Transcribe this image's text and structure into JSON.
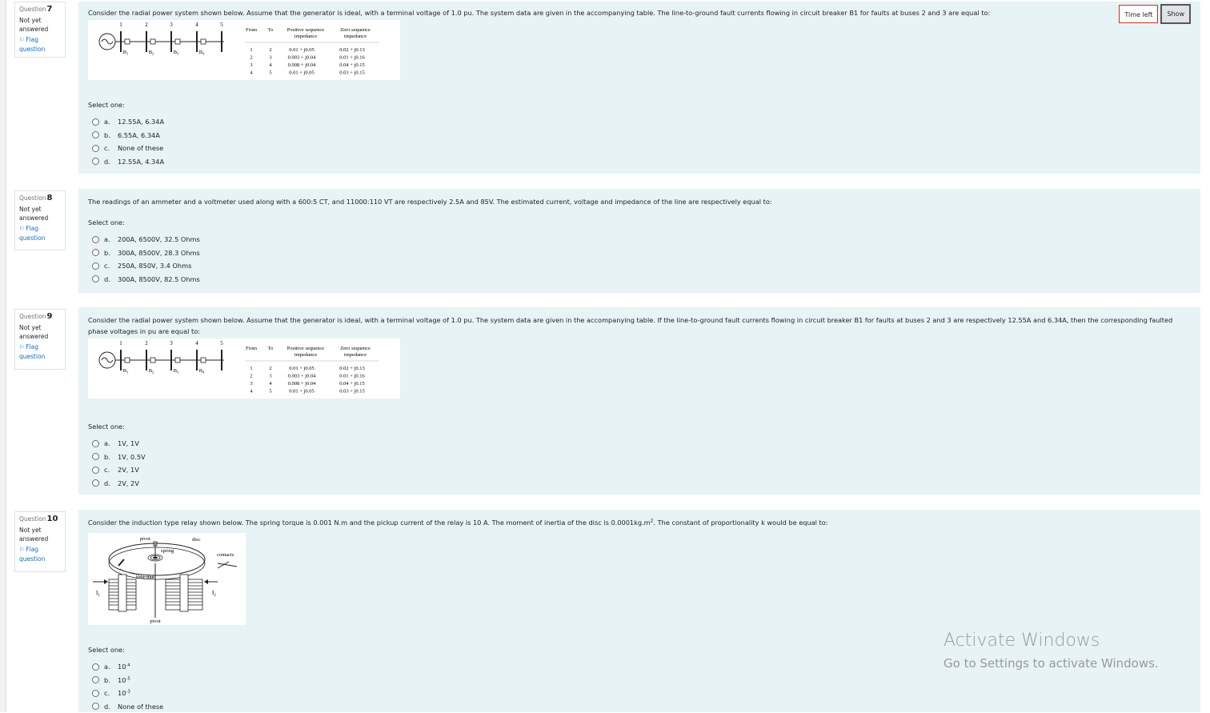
{
  "timer": {
    "label": "Time left",
    "show_label": "Show"
  },
  "watermark": {
    "title": "Activate Windows",
    "subtitle": "Go to Settings to activate Windows."
  },
  "figures": {
    "power_system": {
      "bus_numbers": [
        "1",
        "2",
        "3",
        "4",
        "5"
      ],
      "breakers": [
        "B",
        "B",
        "B",
        "B"
      ],
      "breaker_subscripts": [
        "1",
        "2",
        "3",
        "4"
      ],
      "table": {
        "headers": [
          "From",
          "To",
          "Positive sequence",
          "impedance",
          "Zero sequence",
          "impedance"
        ],
        "rows": [
          [
            "1",
            "2",
            "0.01 + j0.05",
            "0.02 + j0.13"
          ],
          [
            "2",
            "3",
            "0.003 + j0.04",
            "0.01 + j0.16"
          ],
          [
            "3",
            "4",
            "0.008 + j0.04",
            "0.04 + j0.15"
          ],
          [
            "4",
            "5",
            "0.01 + j0.05",
            "0.03 + j0.15"
          ]
        ]
      }
    },
    "relay": {
      "labels": {
        "pivot_top": "pivot",
        "disc": "disc",
        "spring": "spring",
        "contacts": "contacts",
        "time_dial": "time dial",
        "i1": "I",
        "i1_sub": "1",
        "i2": "I",
        "i2_sub": "2",
        "pivot_bottom": "pivot"
      }
    }
  },
  "questions": [
    {
      "qno_label": "Question",
      "number": "7",
      "state": "Not yet answered",
      "flag": "Flag question",
      "text": "Consider the radial power system shown below. Assume that the generator is ideal, with a terminal voltage of 1.0 pu. The system data are given in the accompanying table. The line-to-ground fault currents flowing in circuit breaker B1 for faults at buses 2 and 3 are equal to:",
      "select_one": "Select one:",
      "answers": [
        {
          "letter": "a.",
          "text": "12.55A, 6.34A"
        },
        {
          "letter": "b.",
          "text": "6.55A, 6.34A"
        },
        {
          "letter": "c.",
          "text": "None of these"
        },
        {
          "letter": "d.",
          "text": "12.55A, 4.34A"
        }
      ]
    },
    {
      "qno_label": "Question",
      "number": "8",
      "state": "Not yet answered",
      "flag": "Flag question",
      "text": "The readings of an ammeter and a voltmeter used along with a 600:5 CT, and 11000:110 VT are respectively 2.5A and 85V. The estimated current, voltage and impedance of the line are respectively equal to:",
      "select_one": "Select one:",
      "answers": [
        {
          "letter": "a.",
          "text": "200A, 6500V, 32.5 Ohms"
        },
        {
          "letter": "b.",
          "text": "300A, 8500V, 28.3 Ohms"
        },
        {
          "letter": "c.",
          "text": "250A, 850V, 3.4 Ohms"
        },
        {
          "letter": "d.",
          "text": "300A, 8500V, 82.5 Ohms"
        }
      ]
    },
    {
      "qno_label": "Question",
      "number": "9",
      "state": "Not yet answered",
      "flag": "Flag question",
      "text": "Consider the radial power system shown below. Assume that the generator is ideal, with a terminal voltage of 1.0 pu. The system data are given in the accompanying table. If the line-to-ground fault currents flowing in circuit breaker B1 for faults at buses 2 and 3 are respectively 12.55A and 6.34A, then the corresponding faulted phase voltages in pu are equal to:",
      "select_one": "Select one:",
      "answers": [
        {
          "letter": "a.",
          "text": "1V, 1V"
        },
        {
          "letter": "b.",
          "text": "1V, 0.5V"
        },
        {
          "letter": "c.",
          "text": "2V, 1V"
        },
        {
          "letter": "d.",
          "text": "2V, 2V"
        }
      ]
    },
    {
      "qno_label": "Question",
      "number": "10",
      "state": "Not yet answered",
      "flag": "Flag question",
      "text_before": "Consider the induction type relay shown below. The spring torque is 0.001 N.m and the pickup current of the relay is 10 A. The moment of inertia of the disc is 0.0001kg.m",
      "text_sup": "2",
      "text_after": ". The constant of proportionality k would be equal to:",
      "select_one": "Select one:",
      "answers": [
        {
          "letter": "a.",
          "base": "10",
          "exp": "-4"
        },
        {
          "letter": "b.",
          "base": "10",
          "exp": "-5"
        },
        {
          "letter": "c.",
          "base": "10",
          "exp": "-3"
        },
        {
          "letter": "d.",
          "text": "None of these"
        }
      ]
    }
  ]
}
